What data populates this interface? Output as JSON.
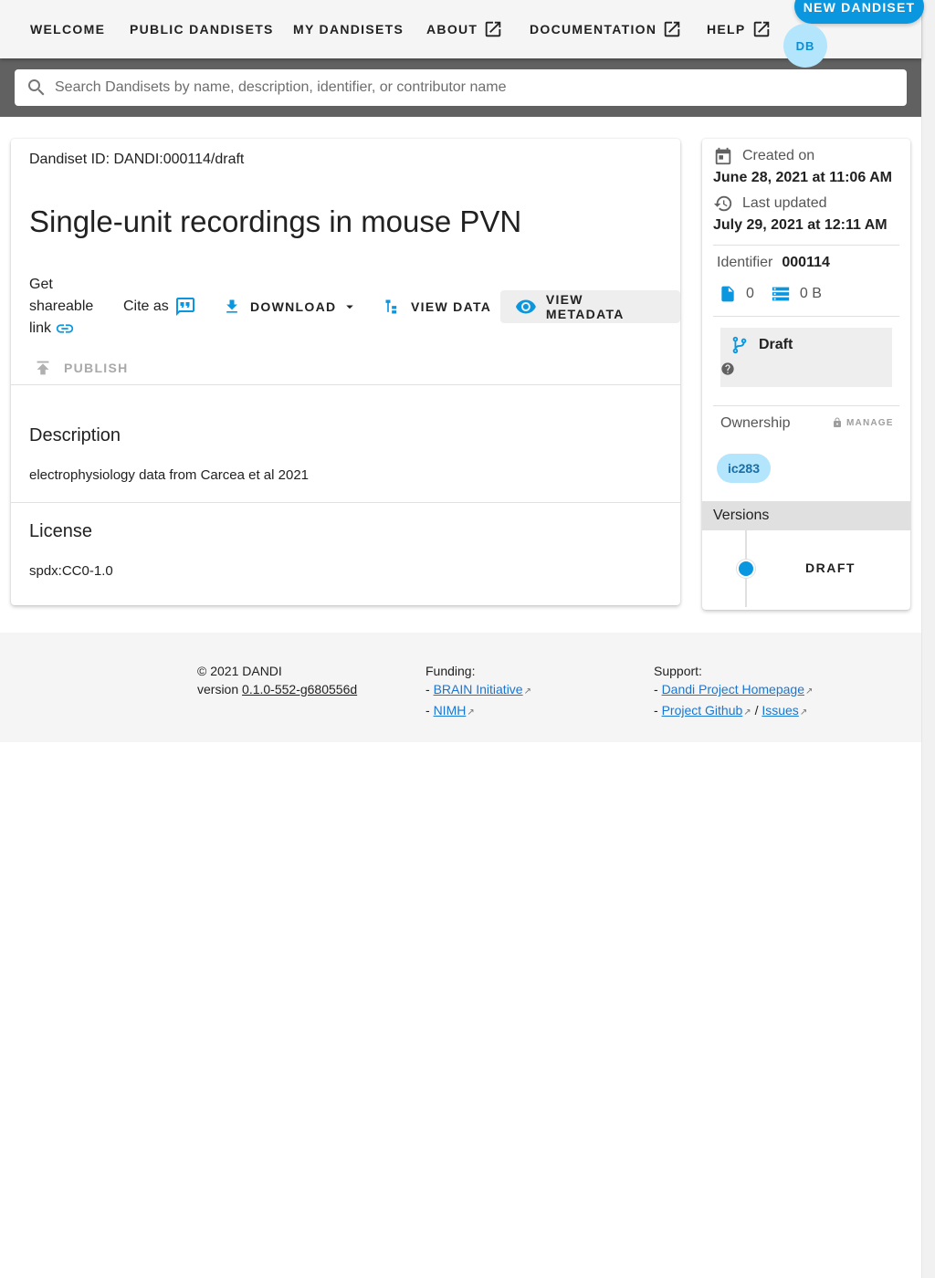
{
  "nav": {
    "items": [
      {
        "label": "Welcome",
        "external": false
      },
      {
        "label": "Public Dandisets",
        "external": false
      },
      {
        "label": "My Dandisets",
        "external": false
      },
      {
        "label": "About",
        "external": true
      },
      {
        "label": "Documentation",
        "external": true
      },
      {
        "label": "Help",
        "external": true
      }
    ],
    "new_dandiset_label": "New Dandiset",
    "avatar_initials": "DB"
  },
  "search": {
    "placeholder": "Search Dandisets by name, description, identifier, or contributor name",
    "value": ""
  },
  "dandiset": {
    "id_label": "Dandiset ID: DANDI:000114/draft",
    "title": "Single-unit recordings in mouse PVN",
    "share_label": "Get shareable link",
    "cite_label": "Cite as",
    "download_label": "Download",
    "view_data_label": "View Data",
    "view_metadata_label": "View Metadata",
    "publish_label": "Publish",
    "description_heading": "Description",
    "description": "electrophysiology data from Carcea et al 2021",
    "license_heading": "License",
    "license": "spdx:CC0-1.0"
  },
  "sidebar": {
    "created_label": "Created on",
    "created_value": "June 28, 2021 at 11:06 AM",
    "updated_label": "Last updated",
    "updated_value": "July 29, 2021 at 12:11 AM",
    "identifier_label": "Identifier",
    "identifier_value": "000114",
    "file_count": "0",
    "size": "0 B",
    "status_label": "Draft",
    "ownership_label": "Ownership",
    "manage_label": "Manage",
    "owners": [
      "ic283"
    ],
    "versions_heading": "Versions",
    "versions": [
      "Draft"
    ]
  },
  "footer": {
    "copyright": "© 2021 DANDI",
    "version_prefix": "version ",
    "version": "0.1.0-552-g680556d",
    "funding_heading": "Funding:",
    "funding_links": [
      "BRAIN Initiative",
      "NIMH"
    ],
    "support_heading": "Support:",
    "support_link_1": "Dandi Project Homepage",
    "support_link_2": "Project Github",
    "support_separator": "/",
    "support_link_3": "Issues"
  },
  "colors": {
    "accent": "#0a97e0",
    "chip_bg": "#b3e5fc",
    "search_band": "#616161",
    "topbar": "#f5f5f5"
  }
}
